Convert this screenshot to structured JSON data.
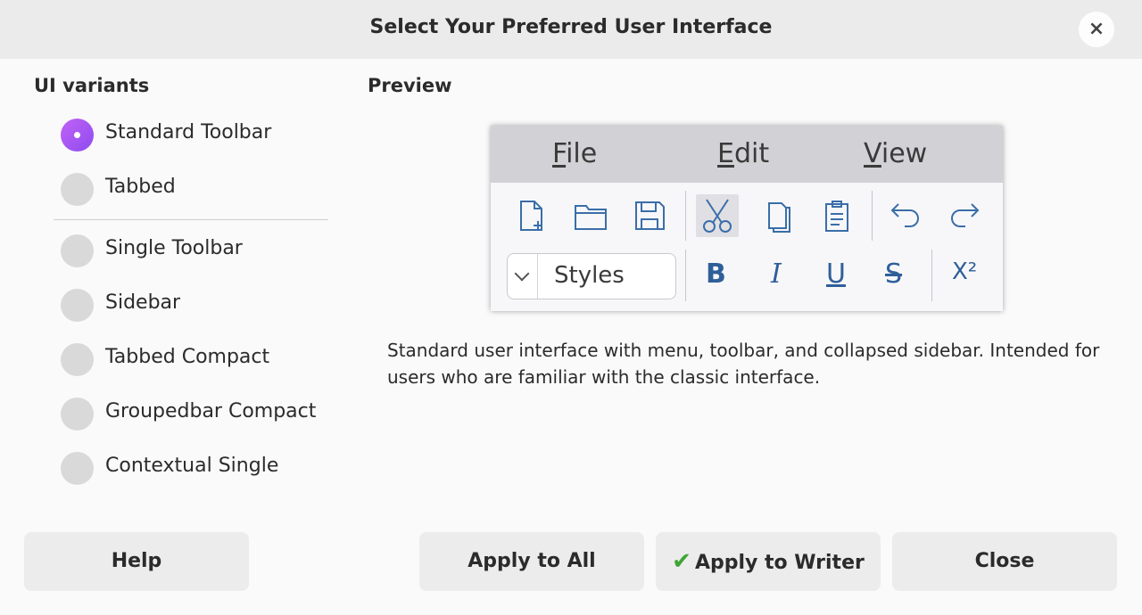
{
  "dialog": {
    "title": "Select Your Preferred User Interface",
    "close_icon": "×"
  },
  "variants": {
    "heading": "UI variants",
    "selected": "Standard Toolbar",
    "items": [
      {
        "label": "Standard Toolbar",
        "selected": true
      },
      {
        "label": "Tabbed",
        "selected": false
      },
      {
        "label": "Single Toolbar",
        "selected": false
      },
      {
        "label": "Sidebar",
        "selected": false
      },
      {
        "label": "Tabbed Compact",
        "selected": false
      },
      {
        "label": "Groupedbar Compact",
        "selected": false
      },
      {
        "label": "Contextual Single",
        "selected": false
      }
    ]
  },
  "preview": {
    "heading": "Preview",
    "menu": [
      {
        "mnemonic": "F",
        "rest": "ile"
      },
      {
        "mnemonic": "E",
        "rest": "dit"
      },
      {
        "mnemonic": "V",
        "rest": "iew"
      }
    ],
    "toolbar_icons": [
      "new-document-icon",
      "open-folder-icon",
      "save-icon",
      "cut-icon",
      "copy-icon",
      "paste-icon",
      "undo-icon",
      "redo-icon"
    ],
    "styles_box": "Styles",
    "format_buttons": {
      "bold": "B",
      "italic": "I",
      "underline": "U",
      "strike": "S",
      "superscript": "X²"
    },
    "description": "Standard user interface with menu, toolbar, and collapsed sidebar. Intended for users who are familiar with the classic interface."
  },
  "buttons": {
    "help": "Help",
    "apply_all": "Apply to All",
    "apply_writer": "Apply to Writer",
    "apply_writer_icon": "✔",
    "close": "Close"
  },
  "colors": {
    "accent": "#9b55f2",
    "check": "#3fa535",
    "icon_blue": "#3a6ea8"
  }
}
